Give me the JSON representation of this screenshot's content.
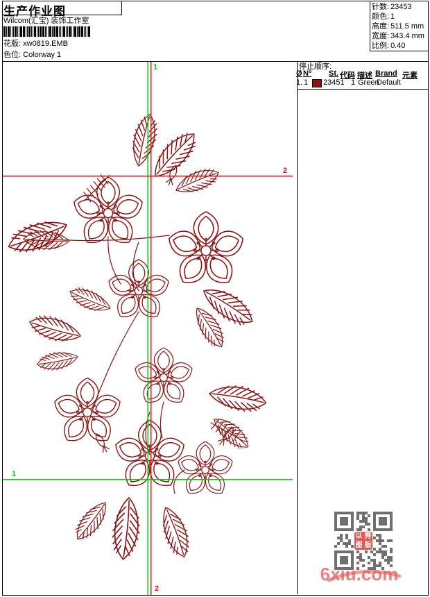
{
  "header": {
    "title": "生产作业图",
    "subtitle": "Wilcom(汇宝) 装饰工作室",
    "pattern_label": "花版:",
    "pattern_value": "xw0819.EMB",
    "colorway_label": "色位:",
    "colorway_value": "Colorway 1"
  },
  "stats": {
    "items": [
      {
        "label": "针数:",
        "value": "23453"
      },
      {
        "label": "颜色:",
        "value": "1"
      },
      {
        "label": "高度:",
        "value": "511.5 mm"
      },
      {
        "label": "宽度:",
        "value": "343.4 mm"
      },
      {
        "label": "比例:",
        "value": "0.40"
      }
    ]
  },
  "stop_sequence": {
    "title": "停止顺序:",
    "columns": [
      "Ø",
      "Nº",
      "St.",
      "代码",
      "描述",
      "Brand",
      "元素"
    ],
    "rows": [
      {
        "index": "1.",
        "no": "1",
        "swatch_color": "#8b1111",
        "st": "23451",
        "code": "1",
        "desc": "Green",
        "brand": "Default",
        "element": ""
      }
    ]
  },
  "guides": {
    "marker1_label": "1",
    "marker2_label": "2",
    "green_color": "#00cc00",
    "red_color": "#ee1111"
  },
  "artwork": {
    "description": "single-color floral embroidery line art (wild roses with leaves)",
    "stroke_color": "#8b1111"
  },
  "watermark": {
    "text": "6xiu.com",
    "color": "#e05a5a",
    "qr_seal_chars": [
      "以",
      "秀",
      "图",
      "版"
    ]
  }
}
